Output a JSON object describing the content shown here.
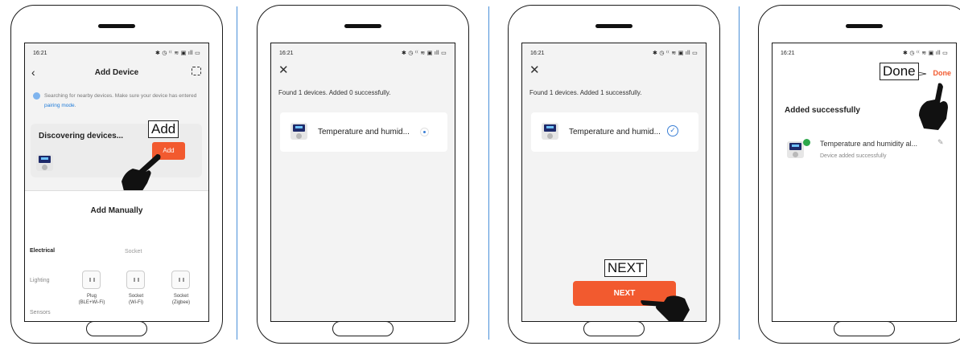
{
  "status": {
    "time": "16:21",
    "icons": "✱ ◷ ⁽⁽ ≋ ▣ ıll ▭"
  },
  "step1": {
    "title": "Add Device",
    "info_text": "Searching for nearby devices. Make sure your device has entered ",
    "info_link": "pairing mode",
    "info_end": ".",
    "discovering": "Discovering devices...",
    "add_button": "Add",
    "callout": "Add",
    "add_manually": "Add Manually",
    "categories": [
      "Electrical",
      "Lighting",
      "Sensors"
    ],
    "socket_header": "Socket",
    "products": [
      {
        "label": "Plug\n(BLE+Wi-Fi)"
      },
      {
        "label": "Socket\n(Wi-Fi)"
      },
      {
        "label": "Socket\n(Zigbee)"
      }
    ]
  },
  "step2": {
    "found": "Found 1 devices. Added 0 successfully.",
    "device_name": "Temperature and humid..."
  },
  "step3": {
    "found": "Found 1 devices. Added 1 successfully.",
    "device_name": "Temperature and humid...",
    "next_button": "NEXT",
    "callout": "NEXT"
  },
  "step4": {
    "done": "Done",
    "callout": "Done",
    "added_title": "Added successfully",
    "device_name": "Temperature and humidity al...",
    "device_sub": "Device added successfully"
  },
  "colors": {
    "accent": "#f25a2f",
    "link": "#1f7bd8",
    "divider": "#4a90d9"
  }
}
